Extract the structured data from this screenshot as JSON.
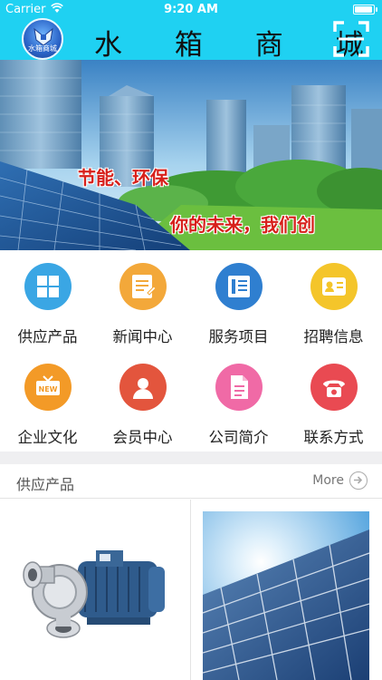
{
  "status_bar": {
    "carrier": "Carrier",
    "time": "9:20 AM",
    "battery_level": 1.0
  },
  "header": {
    "logo_text": "水箱商城",
    "title": "水 箱 商 城",
    "scan_icon": "scan-icon",
    "background": "#1fd1f2"
  },
  "banner": {
    "slogan_line1": "节能、环保",
    "slogan_line2": "你的未来，我们创"
  },
  "menu": [
    {
      "label": "供应产品",
      "icon": "grid-icon",
      "color": "#3aa6e4"
    },
    {
      "label": "新闻中心",
      "icon": "note-icon",
      "color": "#f3a83a"
    },
    {
      "label": "服务项目",
      "icon": "book-icon",
      "color": "#2f7fd0"
    },
    {
      "label": "招聘信息",
      "icon": "id-card-icon",
      "color": "#f4c52a"
    },
    {
      "label": "企业文化",
      "icon": "new-badge-icon",
      "color": "#f39a27"
    },
    {
      "label": "会员中心",
      "icon": "user-icon",
      "color": "#e3553d"
    },
    {
      "label": "公司简介",
      "icon": "document-icon",
      "color": "#f06aa6"
    },
    {
      "label": "联系方式",
      "icon": "phone-icon",
      "color": "#e94a52"
    }
  ],
  "section": {
    "title": "供应产品",
    "more_label": "More"
  },
  "products": [
    {
      "image": "water-pump-image"
    },
    {
      "image": "solar-panel-image"
    }
  ]
}
